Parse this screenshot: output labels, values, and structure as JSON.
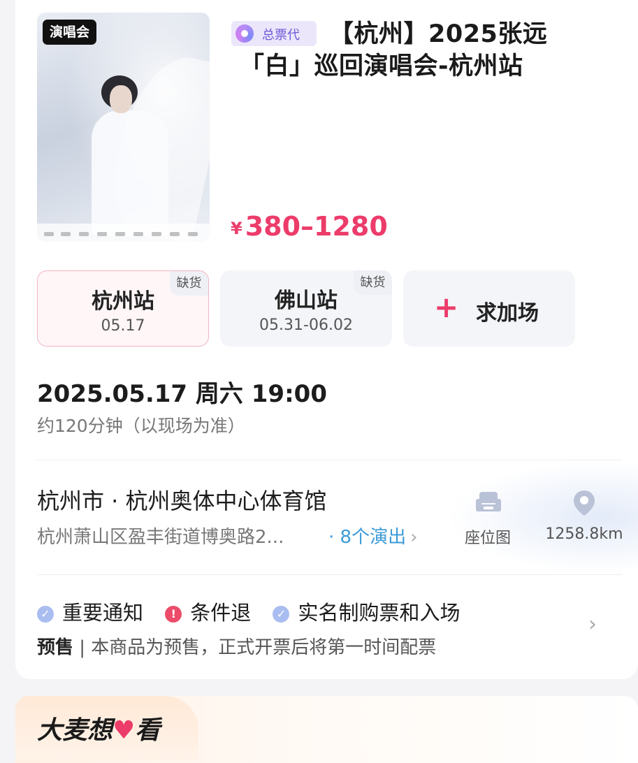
{
  "poster": {
    "category_badge": "演唱会"
  },
  "event": {
    "agent_tag": "总票代",
    "title": "【杭州】2025张远「白」巡回演唱会-杭州站",
    "price_currency": "¥",
    "price_range": "380–1280"
  },
  "sessions": [
    {
      "name": "杭州站",
      "date": "05.17",
      "stock": "缺货",
      "selected": true
    },
    {
      "name": "佛山站",
      "date": "05.31-06.02",
      "stock": "缺货",
      "selected": false
    }
  ],
  "add_session": {
    "icon": "plus-icon",
    "label": "求加场"
  },
  "schedule": {
    "datetime": "2025.05.17 周六 19:00",
    "duration": "约120分钟（以现场为准）"
  },
  "venue": {
    "name": "杭州市 · 杭州奥体中心体育馆",
    "address": "杭州萧山区盈丰街道博奥路2...",
    "shows": "· 8个演出",
    "chevron": "›",
    "seat_map_label": "座位图",
    "distance": "1258.8km"
  },
  "notices": {
    "items": [
      {
        "label": "重要通知",
        "icon": "check-circle-icon",
        "color": "#a9bdf0"
      },
      {
        "label": "条件退",
        "icon": "exclamation-circle-icon",
        "color": "#ec4c6a"
      },
      {
        "label": "实名制购票和入场",
        "icon": "check-circle-icon",
        "color": "#a9bdf0"
      }
    ],
    "presale_tag": "预售",
    "presale_text": " | 本商品为预售，正式开票后将第一时间配票",
    "chevron": "›"
  },
  "want_section": {
    "title_part1": "大麦想",
    "heart": "♥",
    "title_part2": "看"
  },
  "colors": {
    "accent": "#ec3c6a",
    "link": "#3c9bd8",
    "agent": "#6c5ad8"
  }
}
